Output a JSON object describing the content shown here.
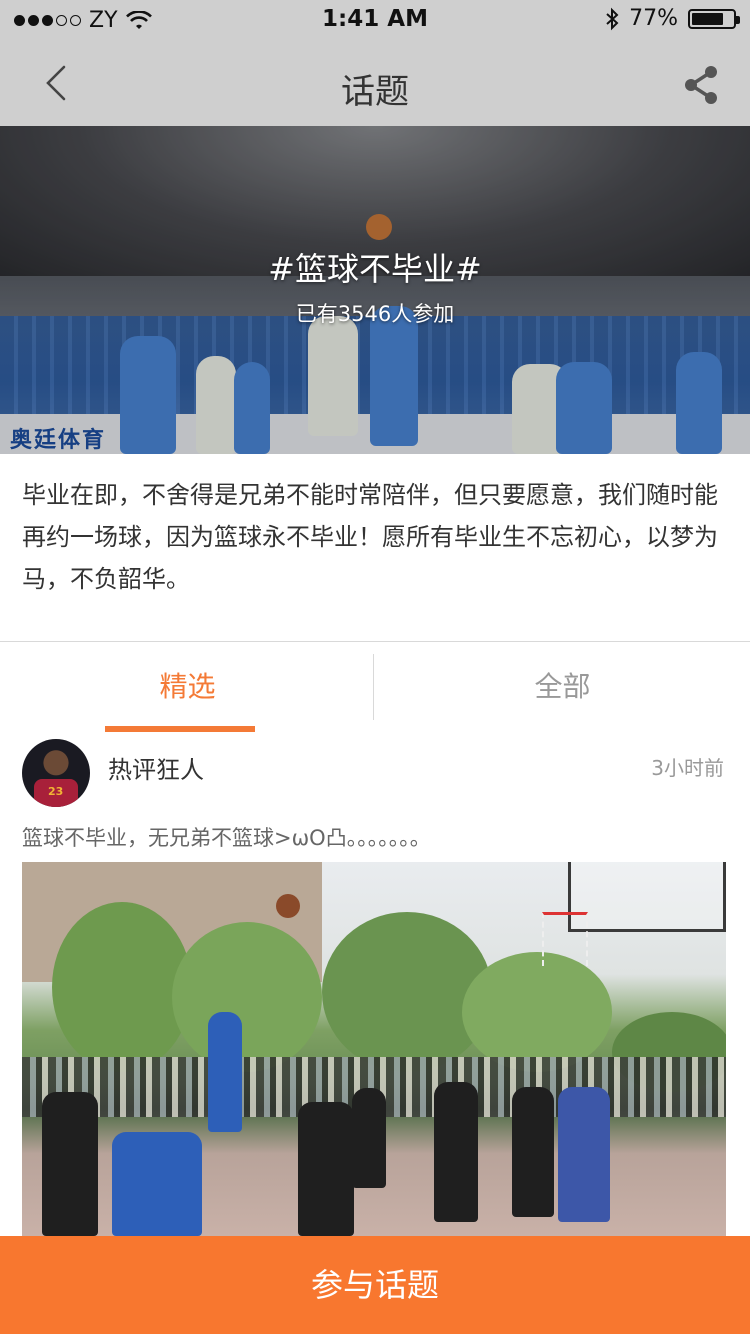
{
  "status_bar": {
    "carrier": "ZY",
    "time": "1:41 AM",
    "battery_percent": "77%",
    "battery_level": 0.77,
    "signal_bars": 3,
    "signal_total": 5
  },
  "nav": {
    "title": "话题",
    "back_icon": "chevron-left-icon",
    "share_icon": "share-icon"
  },
  "banner": {
    "title": "#篮球不毕业#",
    "participants": "已有3546人参加",
    "board_text": "奥廷体育"
  },
  "topic_description": "毕业在即，不舍得是兄弟不能时常陪伴，但只要愿意，我们随时能再约一场球，因为篮球永不毕业！愿所有毕业生不忘初心，以梦为马，不负韶华。",
  "tabs": {
    "items": [
      {
        "label": "精选",
        "active": true
      },
      {
        "label": "全部",
        "active": false
      }
    ]
  },
  "post": {
    "username": "热评狂人",
    "time": "3小时前",
    "content": "篮球不毕业，无兄弟不篮球>ωO凸。。。。。。。",
    "avatar_number": "23"
  },
  "cta": {
    "label": "参与话题"
  },
  "colors": {
    "accent": "#f47a36",
    "cta_background": "#f8772f",
    "nav_background": "#cfcfcf",
    "muted_text": "#999999"
  }
}
